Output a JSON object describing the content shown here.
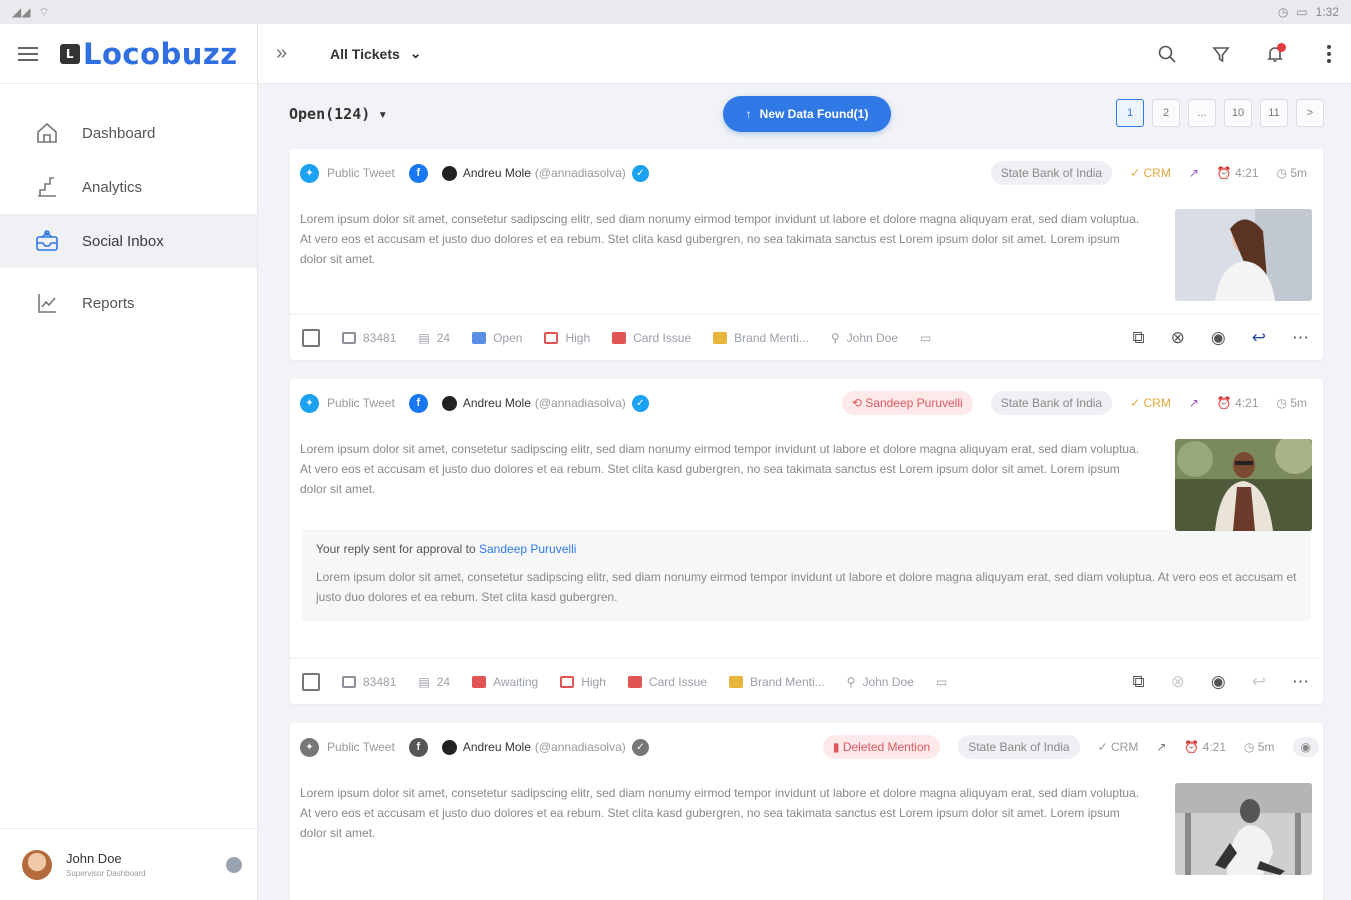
{
  "status": {
    "time": "1:32"
  },
  "brand": {
    "name": "Locobuzz",
    "mark": "L"
  },
  "nav": [
    {
      "label": "Dashboard",
      "icon": "home-icon"
    },
    {
      "label": "Analytics",
      "icon": "analytics-icon"
    },
    {
      "label": "Social Inbox",
      "icon": "inbox-icon",
      "active": true
    },
    {
      "label": "Reports",
      "icon": "reports-icon"
    }
  ],
  "user": {
    "name": "John Doe",
    "role": "Supervisor Dashboard"
  },
  "header": {
    "tickets_label": "All Tickets"
  },
  "toolbar": {
    "open_label": "Open(124)",
    "new_data_label": "New Data Found(1)",
    "pages": [
      "1",
      "2",
      "...",
      "10",
      "11",
      ">"
    ]
  },
  "cards": [
    {
      "channel": "Public Tweet",
      "author": "Andreu Mole",
      "handle": "(@annadiasolva)",
      "tag": "",
      "brand": "State Bank of India",
      "crm": "CRM",
      "time": "4:21",
      "age": "5m",
      "body": "Lorem ipsum dolor sit amet, consetetur sadipscing elitr, sed diam nonumy eirmod tempor invidunt ut labore et dolore magna aliquyam erat, sed diam voluptua. At vero eos et accusam et justo duo dolores et ea rebum. Stet clita kasd gubergren, no sea takimata sanctus est Lorem ipsum dolor sit amet. Lorem ipsum dolor sit amet.",
      "footer": {
        "id": "83481",
        "count": "24",
        "status": "Open",
        "priority": "High",
        "category": "Card Issue",
        "mention": "Brand Menti...",
        "assignee": "John Doe"
      }
    },
    {
      "channel": "Public Tweet",
      "author": "Andreu Mole",
      "handle": "(@annadiasolva)",
      "tag": "Sandeep Puruvelli",
      "brand": "State Bank of India",
      "crm": "CRM",
      "time": "4:21",
      "age": "5m",
      "body": "Lorem ipsum dolor sit amet, consetetur sadipscing elitr, sed diam nonumy eirmod tempor invidunt ut labore et dolore magna aliquyam erat, sed diam voluptua. At vero eos et accusam et justo duo dolores et ea rebum. Stet clita kasd gubergren, no sea takimata sanctus est Lorem ipsum dolor sit amet. Lorem ipsum dolor sit amet.",
      "approval": {
        "prefix": "Your reply sent for approval to",
        "to": "Sandeep Puruvelli",
        "text": "Lorem ipsum dolor sit amet, consetetur sadipscing elitr, sed diam nonumy eirmod tempor invidunt ut labore et dolore magna aliquyam erat, sed diam voluptua. At vero eos et accusam et justo duo dolores et ea rebum. Stet clita kasd gubergren."
      },
      "footer": {
        "id": "83481",
        "count": "24",
        "status": "Awaiting",
        "priority": "High",
        "category": "Card Issue",
        "mention": "Brand Menti...",
        "assignee": "John Doe"
      }
    },
    {
      "channel": "Public Tweet",
      "author": "Andreu Mole",
      "handle": "(@annadiasolva)",
      "tag": "Deleted Mention",
      "brand": "State Bank of India",
      "crm": "CRM",
      "time": "4:21",
      "age": "5m",
      "body": "Lorem ipsum dolor sit amet, consetetur sadipscing elitr, sed diam nonumy eirmod tempor invidunt ut labore et dolore magna aliquyam erat, sed diam voluptua. At vero eos et accusam et justo duo dolores et ea rebum. Stet clita kasd gubergren, no sea takimata sanctus est Lorem ipsum dolor sit amet. Lorem ipsum dolor sit amet."
    }
  ]
}
